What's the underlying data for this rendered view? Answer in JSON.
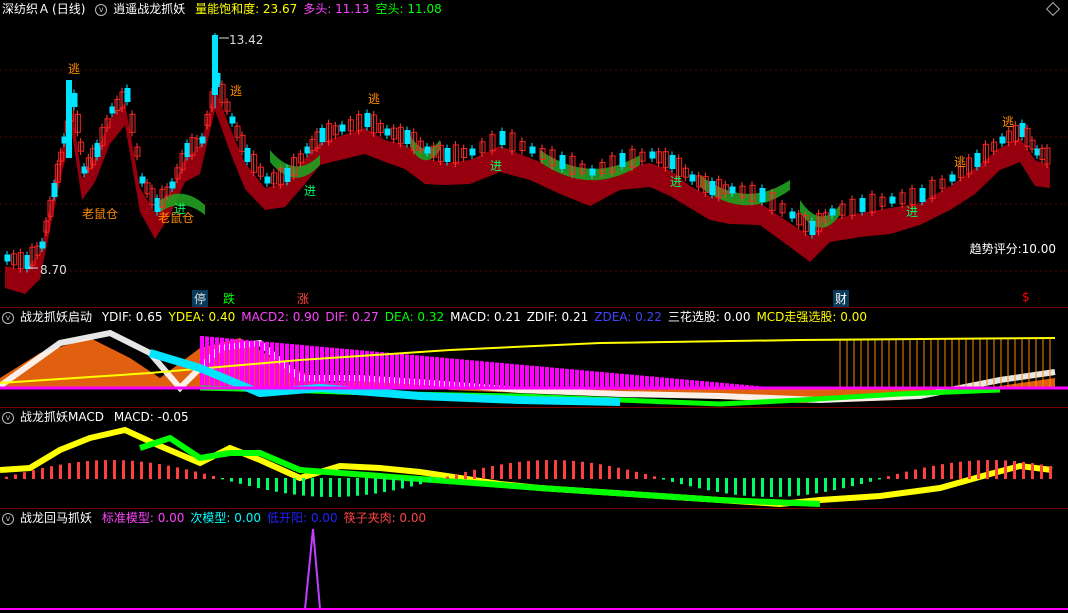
{
  "main": {
    "stock_name": "深纺织Ａ",
    "period": "(日线)",
    "indicator": "逍遥战龙抓妖",
    "items": [
      {
        "label": "量能饱和度",
        "value": "23.67",
        "color": "#ffff00"
      },
      {
        "label": "多头",
        "value": "11.13",
        "color": "#ff44ff"
      },
      {
        "label": "空头",
        "value": "11.08",
        "color": "#00ff00"
      }
    ],
    "high_label": "13.42",
    "low_label": "8.70",
    "trend_score": "趋势评分:10.00",
    "signals": {
      "escape": "逃",
      "enter": "进",
      "mouse": "老鼠仓"
    },
    "markers": [
      {
        "text": "停",
        "color": "#00ffff"
      },
      {
        "text": "跌",
        "color": "#00ff00"
      },
      {
        "text": "涨",
        "color": "#ff4444"
      },
      {
        "text": "财",
        "color": "#00aaff"
      },
      {
        "text": "$",
        "color": "#ff0000"
      }
    ]
  },
  "pane2": {
    "name": "战龙抓妖启动",
    "items": [
      {
        "label": "YDIF",
        "value": "0.65",
        "color": "#ffffff"
      },
      {
        "label": "YDEA",
        "value": "0.40",
        "color": "#ffff00"
      },
      {
        "label": "MACD2",
        "value": "0.90",
        "color": "#ff44ff"
      },
      {
        "label": "DIF",
        "value": "0.27",
        "color": "#ff44ff"
      },
      {
        "label": "DEA",
        "value": "0.32",
        "color": "#00ff00"
      },
      {
        "label": "MACD",
        "value": "0.21",
        "color": "#ffffff"
      },
      {
        "label": "ZDIF",
        "value": "0.21",
        "color": "#ffffff"
      },
      {
        "label": "ZDEA",
        "value": "0.22",
        "color": "#4444ff"
      },
      {
        "label": "三花选股",
        "value": "0.00",
        "color": "#ffffff"
      },
      {
        "label": "MCD走强选股",
        "value": "0.00",
        "color": "#ffff00"
      }
    ]
  },
  "pane3": {
    "name": "战龙抓妖MACD",
    "items": [
      {
        "label": "MACD",
        "value": "-0.05",
        "color": "#ffffff"
      }
    ]
  },
  "pane4": {
    "name": "战龙回马抓妖",
    "items": [
      {
        "label": "标准模型",
        "value": "0.00",
        "color": "#ff44ff"
      },
      {
        "label": "次模型",
        "value": "0.00",
        "color": "#00ffff"
      },
      {
        "label": "低开阳",
        "value": "0.00",
        "color": "#2222ff"
      },
      {
        "label": "筷子夹肉",
        "value": "0.00",
        "color": "#ff4444"
      }
    ]
  }
}
